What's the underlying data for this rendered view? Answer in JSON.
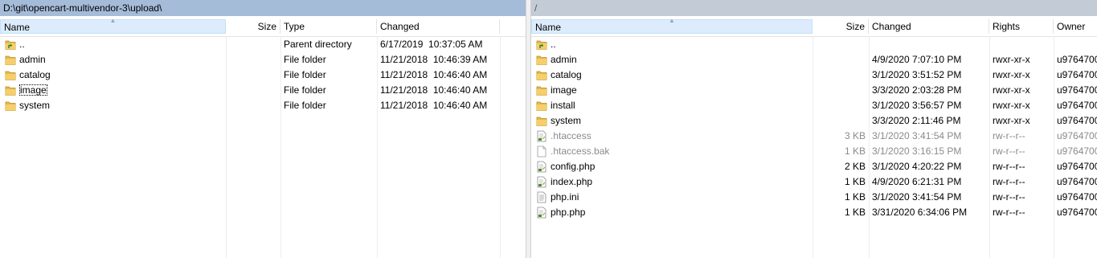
{
  "left": {
    "path": "D:\\git\\opencart-multivendor-3\\upload\\",
    "columns": {
      "name": "Name",
      "size": "Size",
      "type": "Type",
      "changed": "Changed"
    },
    "rows": [
      {
        "name": "..",
        "type": "Parent directory",
        "changed": "6/17/2019  10:37:05 AM",
        "icon": "parent-folder-icon"
      },
      {
        "name": "admin",
        "type": "File folder",
        "changed": "11/21/2018  10:46:39 AM",
        "icon": "folder-icon"
      },
      {
        "name": "catalog",
        "type": "File folder",
        "changed": "11/21/2018  10:46:40 AM",
        "icon": "folder-icon"
      },
      {
        "name": "image",
        "type": "File folder",
        "changed": "11/21/2018  10:46:40 AM",
        "icon": "folder-icon"
      },
      {
        "name": "system",
        "type": "File folder",
        "changed": "11/21/2018  10:46:40 AM",
        "icon": "folder-icon"
      }
    ]
  },
  "right": {
    "path": "/",
    "columns": {
      "name": "Name",
      "size": "Size",
      "changed": "Changed",
      "rights": "Rights",
      "owner": "Owner"
    },
    "rows": [
      {
        "name": "..",
        "size": "",
        "changed": "",
        "rights": "",
        "owner": "",
        "icon": "parent-folder-icon",
        "muted": false
      },
      {
        "name": "admin",
        "size": "",
        "changed": "4/9/2020 7:07:10 PM",
        "rights": "rwxr-xr-x",
        "owner": "u9764700",
        "icon": "folder-icon",
        "muted": false
      },
      {
        "name": "catalog",
        "size": "",
        "changed": "3/1/2020 3:51:52 PM",
        "rights": "rwxr-xr-x",
        "owner": "u9764700",
        "icon": "folder-icon",
        "muted": false
      },
      {
        "name": "image",
        "size": "",
        "changed": "3/3/2020 2:03:28 PM",
        "rights": "rwxr-xr-x",
        "owner": "u9764700",
        "icon": "folder-icon",
        "muted": false
      },
      {
        "name": "install",
        "size": "",
        "changed": "3/1/2020 3:56:57 PM",
        "rights": "rwxr-xr-x",
        "owner": "u9764700",
        "icon": "folder-icon",
        "muted": false
      },
      {
        "name": "system",
        "size": "",
        "changed": "3/3/2020 2:11:46 PM",
        "rights": "rwxr-xr-x",
        "owner": "u9764700",
        "icon": "folder-icon",
        "muted": false
      },
      {
        "name": ".htaccess",
        "size": "3 KB",
        "changed": "3/1/2020 3:41:54 PM",
        "rights": "rw-r--r--",
        "owner": "u9764700",
        "icon": "script-file-icon",
        "muted": true
      },
      {
        "name": ".htaccess.bak",
        "size": "1 KB",
        "changed": "3/1/2020 3:16:15 PM",
        "rights": "rw-r--r--",
        "owner": "u9764700",
        "icon": "file-icon",
        "muted": true
      },
      {
        "name": "config.php",
        "size": "2 KB",
        "changed": "3/1/2020 4:20:22 PM",
        "rights": "rw-r--r--",
        "owner": "u9764700",
        "icon": "script-file-icon",
        "muted": false
      },
      {
        "name": "index.php",
        "size": "1 KB",
        "changed": "4/9/2020 6:21:31 PM",
        "rights": "rw-r--r--",
        "owner": "u9764700",
        "icon": "script-file-icon",
        "muted": false
      },
      {
        "name": "php.ini",
        "size": "1 KB",
        "changed": "3/1/2020 3:41:54 PM",
        "rights": "rw-r--r--",
        "owner": "u9764700",
        "icon": "text-file-icon",
        "muted": false
      },
      {
        "name": "php.php",
        "size": "1 KB",
        "changed": "3/31/2020 6:34:06 PM",
        "rights": "rw-r--r--",
        "owner": "u9764700",
        "icon": "script-file-icon",
        "muted": false
      }
    ]
  },
  "colors": {
    "left_path_bg": "#a5bcd8",
    "right_path_bg": "#c3ccd6",
    "folder": "#e8b94a",
    "sorted_header": "#dcecfc"
  }
}
